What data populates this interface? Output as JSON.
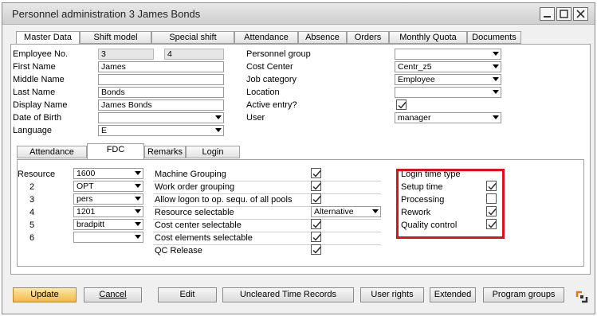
{
  "window": {
    "title": "Personnel administration 3 James Bonds"
  },
  "tabs": [
    "Master Data",
    "Shift model",
    "Special shift",
    "Attendance",
    "Absence",
    "Orders",
    "Monthly Quota",
    "Documents"
  ],
  "left_fields": {
    "employee_no_label": "Employee No.",
    "employee_no_1": "3",
    "employee_no_2": "4",
    "first_name_label": "First Name",
    "first_name": "James",
    "middle_name_label": "Middle Name",
    "middle_name": "",
    "last_name_label": "Last Name",
    "last_name": "Bonds",
    "display_name_label": "Display Name",
    "display_name": "James Bonds",
    "dob_label": "Date of Birth",
    "dob": "",
    "language_label": "Language",
    "language": "E"
  },
  "right_fields": {
    "personnel_group_label": "Personnel group",
    "personnel_group": "",
    "cost_center_label": "Cost Center",
    "cost_center": "Centr_z5",
    "job_category_label": "Job category",
    "job_category": "Employee",
    "location_label": "Location",
    "location": "",
    "active_entry_label": "Active entry?",
    "active_entry": true,
    "user_label": "User",
    "user": "manager"
  },
  "subtabs": [
    "Attendance",
    "FDC",
    "Remarks",
    "Login"
  ],
  "resources": [
    {
      "label": "Resource",
      "value": "1600"
    },
    {
      "label": "2",
      "value": "OPT"
    },
    {
      "label": "3",
      "value": "pers"
    },
    {
      "label": "4",
      "value": "1201"
    },
    {
      "label": "5",
      "value": "bradpitt"
    },
    {
      "label": "6",
      "value": ""
    }
  ],
  "options": [
    {
      "label": "Machine Grouping",
      "checked": true
    },
    {
      "label": "Work order grouping",
      "checked": true
    },
    {
      "label": "Allow logon to op. sequ. of all pools",
      "checked": true
    },
    {
      "label": "Resource selectable",
      "select": "Alternative"
    },
    {
      "label": "Cost center selectable",
      "checked": true
    },
    {
      "label": "Cost elements selectable",
      "checked": true
    },
    {
      "label": "QC Release",
      "checked": true
    }
  ],
  "login_time": {
    "title": "Login time type",
    "items": [
      {
        "label": "Setup time",
        "checked": true
      },
      {
        "label": "Processing",
        "checked": false
      },
      {
        "label": "Rework",
        "checked": true
      },
      {
        "label": "Quality control",
        "checked": true
      }
    ],
    "highlight_color": "#e0101a"
  },
  "buttons": {
    "update": "Update",
    "cancel": "Cancel",
    "edit": "Edit",
    "uncleared": "Uncleared Time Records",
    "user_rights": "User rights",
    "extended": "Extended",
    "program_groups": "Program groups"
  }
}
